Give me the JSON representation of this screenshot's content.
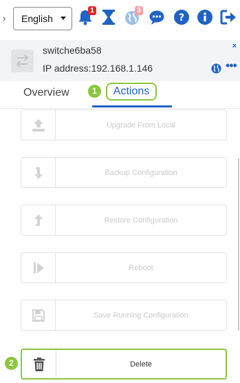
{
  "topbar": {
    "nav_chevron": "›",
    "language": "English",
    "icons": [
      {
        "name": "bell-icon",
        "badge": "1"
      },
      {
        "name": "hourglass-icon",
        "badge": ""
      },
      {
        "name": "globe-icon",
        "badge": "3"
      },
      {
        "name": "chat-icon",
        "badge": ""
      },
      {
        "name": "help-icon",
        "badge": ""
      },
      {
        "name": "info-icon",
        "badge": ""
      },
      {
        "name": "logout-icon",
        "badge": ""
      }
    ]
  },
  "device": {
    "name": "switche6ba58",
    "ip_label": "IP address:",
    "ip_value": "192.168.1.146",
    "close": "×",
    "more": "•••"
  },
  "tabs": {
    "overview": "Overview",
    "actions": "Actions",
    "step_actions": "1"
  },
  "actions": [
    {
      "label": "Upgrade From Local",
      "icon": "upload-icon",
      "enabled": false
    },
    {
      "label": "Backup Configuration",
      "icon": "download-arrow-icon",
      "enabled": false
    },
    {
      "label": "Restore Configuration",
      "icon": "restore-arrow-icon",
      "enabled": false
    },
    {
      "label": "Reboot",
      "icon": "reboot-icon",
      "enabled": false
    },
    {
      "label": "Save Running Configuration",
      "icon": "save-icon",
      "enabled": false
    },
    {
      "label": "Delete",
      "icon": "trash-icon",
      "enabled": true
    }
  ],
  "step_delete": "2",
  "colors": {
    "accent_blue": "#1f63c4",
    "highlight_green": "#8cc63f",
    "badge_red": "#e0282e",
    "disabled_text": "#c9c9c9"
  }
}
